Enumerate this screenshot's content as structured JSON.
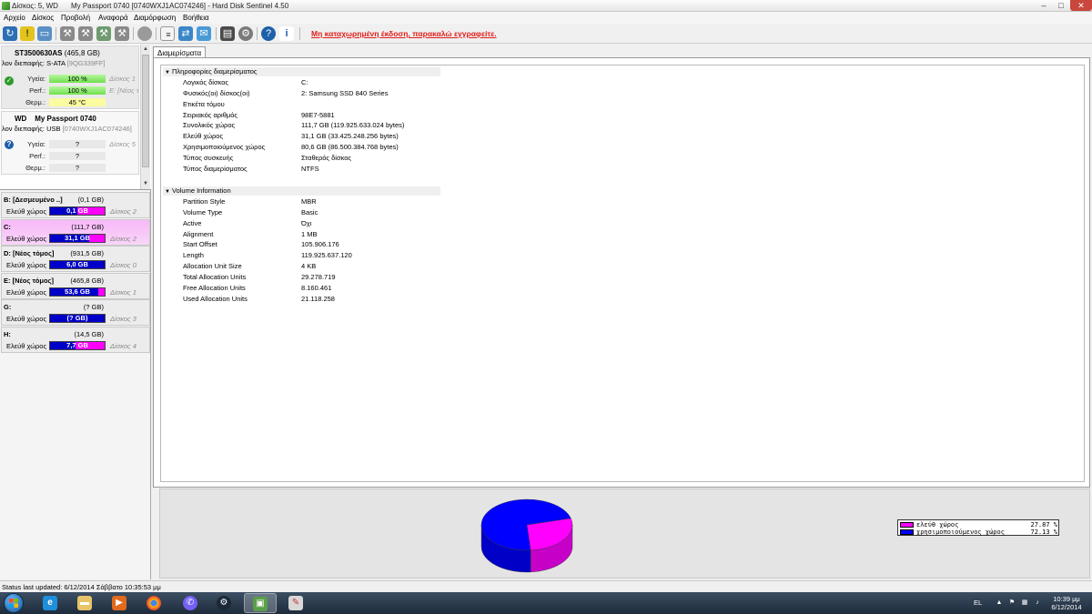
{
  "window": {
    "title_part1": "Δίσκος: 5, WD",
    "title_part2": "My Passport 0740 [0740WXJ1AC074246]",
    "title_part3": "Hard Disk Sentinel 4.50",
    "min_label": "–",
    "max_label": "□",
    "close_label": "✕"
  },
  "menu": [
    "Αρχείο",
    "Δίσκος",
    "Προβολή",
    "Αναφορά",
    "Διαμόρφωση",
    "Βοήθεια"
  ],
  "toolbar": {
    "registration_notice": "Μη καταχωρημένη έκδοση, παρακαλώ εγγραφείτε.",
    "icons": [
      "refresh-icon",
      "warning-icon",
      "disk-test-icon",
      "tool-icon",
      "tool-icon",
      "tool-icon",
      "tool-icon",
      "disk-icon",
      "report-icon",
      "sync-icon",
      "send-icon",
      "monitor-icon",
      "disk-settings-icon",
      "help-icon",
      "info-icon"
    ]
  },
  "disks": [
    {
      "name": "ST3500630AS",
      "size": "(465,8 GB)",
      "interface_label": "λον διεπαφής:",
      "interface_value": "S-ATA",
      "serial": "[9QG339FF]",
      "health_label": "Υγεία:",
      "health_value": "100 %",
      "health_extra": "Δίσκος 1",
      "perf_label": "Perf.:",
      "perf_value": "100 %",
      "perf_extra": "E: [Νέος τ",
      "temp_label": "Θερμ.:",
      "temp_value": "45 °C",
      "status_icon": "check-icon"
    },
    {
      "name": "WD",
      "model": "My Passport 0740",
      "interface_label": "λον διεπαφής:",
      "interface_value": "USB",
      "serial": "[0740WXJ1AC074246]",
      "health_label": "Υγεία:",
      "health_value": "?",
      "health_extra": "Δίσκος 5",
      "perf_label": "Perf.:",
      "perf_value": "?",
      "temp_label": "Θερμ.:",
      "temp_value": "?",
      "status_icon": "question-icon"
    }
  ],
  "volumes": [
    {
      "name": "B: [Δεσμευμένο ..]",
      "size": "(0,1 GB)",
      "free_label": "Ελεύθ χώρος",
      "free_value": "0,1 GB",
      "free_fraction": 0.5,
      "disk": "Δίσκος 2",
      "selected": false
    },
    {
      "name": "C:",
      "size": "(111,7 GB)",
      "free_label": "Ελεύθ χώρος",
      "free_value": "31,1 GB",
      "free_fraction": 0.2787,
      "disk": "Δίσκος 2",
      "selected": true
    },
    {
      "name": "D: [Νέος τόμος]",
      "size": "(931,5 GB)",
      "free_label": "Ελεύθ χώρος",
      "free_value": "6,0 GB",
      "free_fraction": 0.006,
      "disk": "Δίσκος 0",
      "selected": false
    },
    {
      "name": "E: [Νέος τόμος]",
      "size": "(465,8 GB)",
      "free_label": "Ελεύθ χώρος",
      "free_value": "53,6 GB",
      "free_fraction": 0.115,
      "disk": "Δίσκος 1",
      "selected": false
    },
    {
      "name": "G:",
      "size": "(? GB)",
      "free_label": "Ελεύθ χώρος",
      "free_value": "(? GB)",
      "free_fraction": 0,
      "disk": "Δίσκος 3",
      "selected": false
    },
    {
      "name": "H:",
      "size": "(14,5 GB)",
      "free_label": "Ελεύθ χώρος",
      "free_value": "7,7 GB",
      "free_fraction": 0.53,
      "disk": "Δίσκος 4",
      "selected": false
    }
  ],
  "tab": {
    "label": "Διαμερίσματα"
  },
  "partition_info": {
    "title": "Πληροφορίες διαμερίσματος",
    "rows": [
      {
        "k": "Λογικός δίσκος",
        "v": "C:"
      },
      {
        "k": "Φυσικός(οι) δίσκος(οι)",
        "v": "2: Samsung SSD 840 Series"
      },
      {
        "k": "Ετικέτα τόμου",
        "v": ""
      },
      {
        "k": "Σειριακός αριθμός",
        "v": "98E7-5881"
      },
      {
        "k": "Συνολικός χώρος",
        "v": "111,7 GB (119.925.633.024 bytes)"
      },
      {
        "k": "Ελεύθ χώρος",
        "v": "31,1 GB (33.425.248.256 bytes)"
      },
      {
        "k": "Χρησιμοποιούμενος χώρος",
        "v": "80,6 GB (86.500.384.768 bytes)"
      },
      {
        "k": "Τύπος συσκευής",
        "v": "Σταθερός δίσκος"
      },
      {
        "k": "Τύπος διαμερίσματος",
        "v": "NTFS"
      }
    ]
  },
  "volume_info": {
    "title": "Volume Information",
    "rows": [
      {
        "k": "Partition Style",
        "v": "MBR"
      },
      {
        "k": "Volume Type",
        "v": "Basic"
      },
      {
        "k": "Active",
        "v": "Όχι"
      },
      {
        "k": "Alignment",
        "v": "1 MB"
      },
      {
        "k": "Start Offset",
        "v": "105.906.176"
      },
      {
        "k": "Length",
        "v": "119.925.637.120"
      },
      {
        "k": "Allocation Unit Size",
        "v": "4 KB"
      },
      {
        "k": "Total Allocation Units",
        "v": "29.278.719"
      },
      {
        "k": "Free Allocation Units",
        "v": "8.160.461"
      },
      {
        "k": "Used Allocation Units",
        "v": "21.118.258"
      }
    ]
  },
  "chart_data": {
    "type": "pie",
    "labels": [
      "ελεύθ χώρος",
      "χρησιμοποιούμενος χώρος"
    ],
    "values": [
      27.87,
      72.13
    ],
    "colors": [
      "#ff00ff",
      "#0000ff"
    ],
    "legend_values": [
      "27.87 %",
      "72.13 %"
    ],
    "legend_position": "right"
  },
  "status": {
    "text": "Status last updated: 6/12/2014 Σάββατο 10:35:53 μμ"
  },
  "taskbar": {
    "apps": [
      "ie-icon",
      "folder-icon",
      "media-player-icon",
      "chrome-icon",
      "viber-icon",
      "steam-icon",
      "hard-disk-sentinel-icon",
      "paint-icon"
    ],
    "language": "EL",
    "time": "10:39 μμ",
    "date": "6/12/2014"
  }
}
